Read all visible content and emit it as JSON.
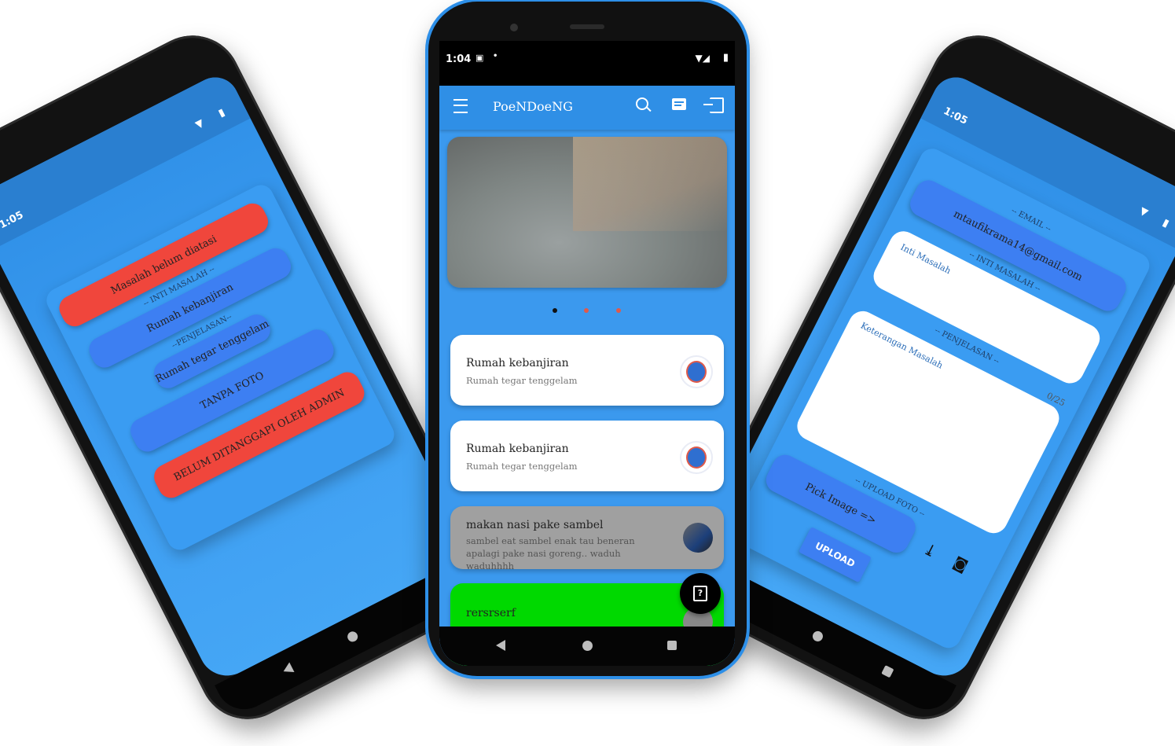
{
  "left_phone": {
    "status": {
      "time": "1:05"
    },
    "status_label": "Masalah belum diatasi",
    "inti_label": "-- INTI MASALAH --",
    "inti_value": "Rumah kebanjiran",
    "penjelasan_label": "--PENJELASAN--",
    "penjelasan_value": "Rumah tegar tenggelam",
    "photo_label": "TANPA FOTO",
    "admin_label": "BELUM DITANGGAPI OLEH ADMIN"
  },
  "center_phone": {
    "status": {
      "time": "1:04"
    },
    "app_title": "PoeNDoeNG",
    "items": [
      {
        "title": "Rumah kebanjiran",
        "subtitle": "Rumah tegar tenggelam"
      },
      {
        "title": "Rumah kebanjiran",
        "subtitle": "Rumah tegar tenggelam"
      },
      {
        "title": "makan nasi pake sambel",
        "subtitle": "sambel eat sambel enak tau beneran apalagi pake nasi goreng.. waduh waduhhhh"
      },
      {
        "title": "rersrserf",
        "subtitle": ""
      }
    ],
    "fab_icon": "help-icon"
  },
  "right_phone": {
    "status": {
      "time": "1:05"
    },
    "email_label": "-- EMAIL --",
    "email_value": "mtaufikrama14@gmail.com",
    "inti_label": "-- INTI MASALAH --",
    "inti_placeholder": "Inti Masalah",
    "penjelasan_label": "-- PENJELASAN --",
    "counter": "0/25",
    "penjelasan_placeholder": "Keterangan Masalah",
    "upload_label": "-- UPLOAD FOTO --",
    "pick_label": "Pick Image =>",
    "upload_button": "UPLOAD"
  },
  "colors": {
    "blue": "#3a9af0",
    "red": "#f0463c",
    "button_blue": "#3d7ff2",
    "green": "#00d900",
    "gray": "#a0a0a0"
  }
}
